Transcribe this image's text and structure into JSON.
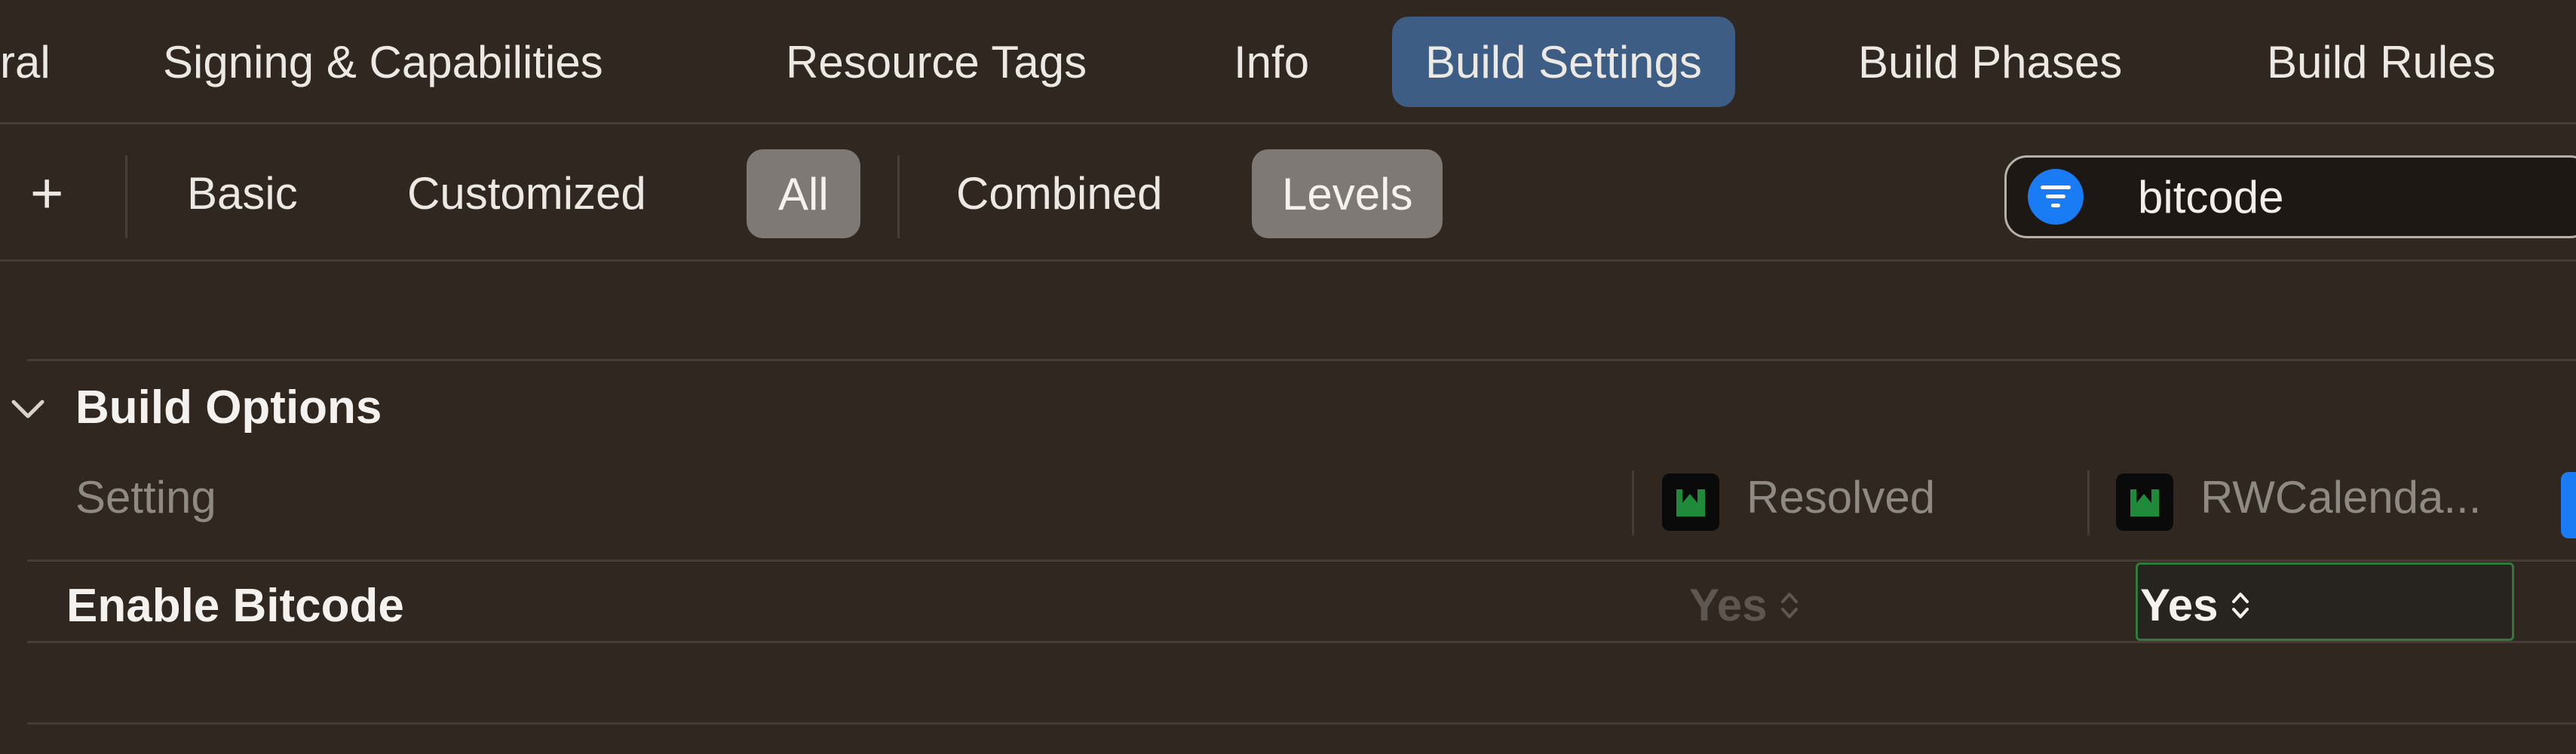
{
  "tabs": [
    {
      "label": "ral"
    },
    {
      "label": "Signing & Capabilities"
    },
    {
      "label": "Resource Tags"
    },
    {
      "label": "Info"
    },
    {
      "label": "Build Settings",
      "active": true
    },
    {
      "label": "Build Phases"
    },
    {
      "label": "Build Rules"
    }
  ],
  "filters": {
    "add": "+",
    "basic": "Basic",
    "customized": "Customized",
    "all": "All",
    "combined": "Combined",
    "levels": "Levels"
  },
  "search": {
    "value": "bitcode"
  },
  "section": {
    "title": "Build Options"
  },
  "columns": {
    "setting": "Setting",
    "resolved": "Resolved",
    "target": "RWCalenda..."
  },
  "rows": [
    {
      "setting": "Enable Bitcode",
      "resolved": "Yes",
      "target": "Yes"
    }
  ],
  "colors": {
    "background": "#302720",
    "active_tab": "#3d5d84",
    "selected_pill": "#7e7975",
    "search_icon": "#1a7cf5",
    "target_icon_green": "#1f8a3a",
    "cell_border": "#2f7a3a"
  },
  "icons": {
    "add": "plus-icon",
    "search": "filter-icon",
    "section": "chevron-down-icon",
    "target": "app-target-icon",
    "stepper": "up-down-chevron-icon"
  }
}
